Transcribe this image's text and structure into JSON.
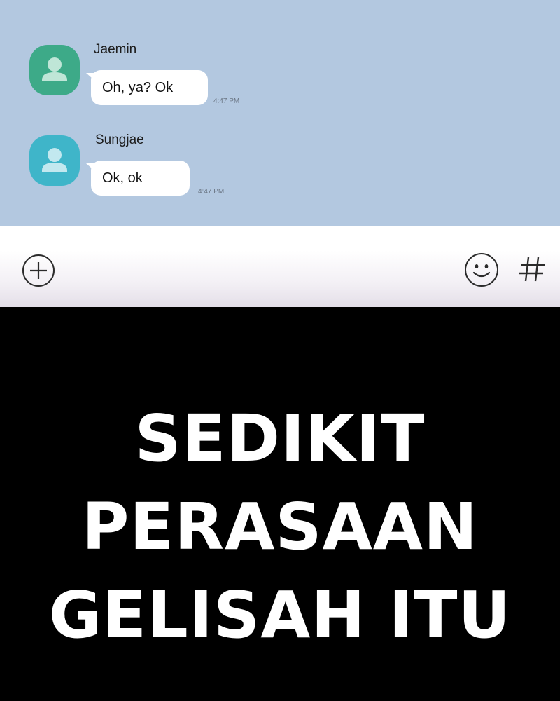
{
  "chat": {
    "messages": [
      {
        "sender": "Jaemin",
        "text": "Oh, ya? Ok",
        "time": "4:47 PM",
        "avatar_color": "#3daa88"
      },
      {
        "sender": "Sungjae",
        "text": "Ok, ok",
        "time": "4:47 PM",
        "avatar_color": "#3fb5c9"
      }
    ]
  },
  "input_bar": {
    "add_icon": "plus-circle-icon",
    "emoji_icon": "smiley-icon",
    "hash_icon": "hash-icon"
  },
  "caption": {
    "lines": [
      "SEDIKIT",
      "PERASAAN",
      "GELISAH ITU"
    ]
  },
  "colors": {
    "chat_background": "#b3c8e0",
    "bubble": "#ffffff",
    "caption_background": "#000000",
    "caption_text": "#ffffff"
  }
}
